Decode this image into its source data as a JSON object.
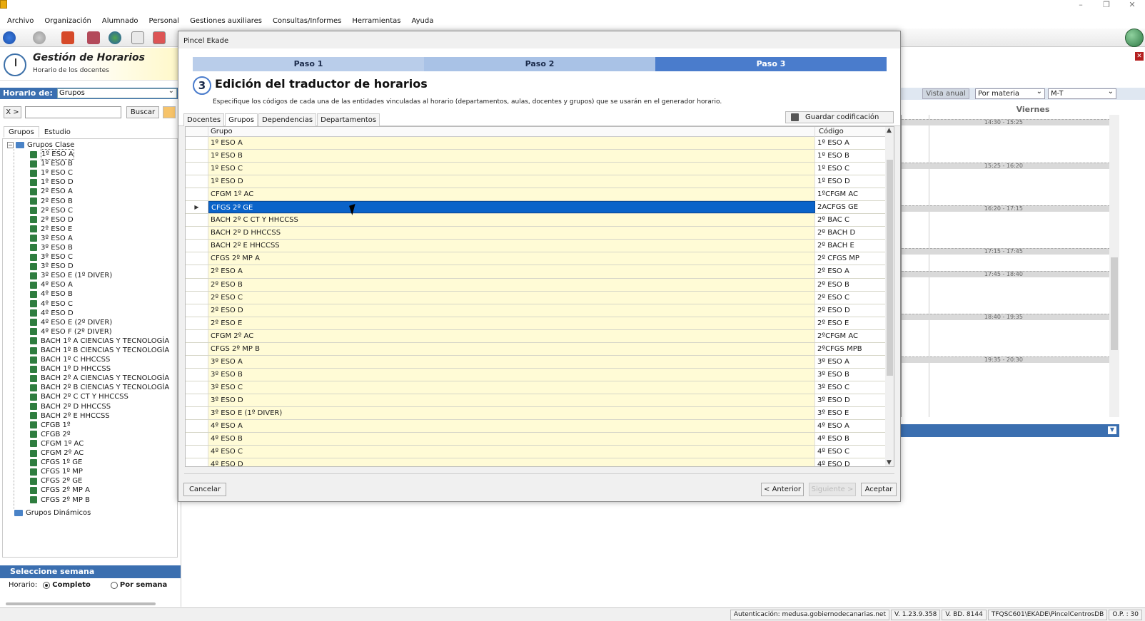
{
  "menu": [
    "Archivo",
    "Organización",
    "Alumnado",
    "Personal",
    "Gestiones auxiliares",
    "Consultas/Informes",
    "Herramientas",
    "Ayuda"
  ],
  "left": {
    "title": "Gestión de Horarios",
    "subtitle": "Horario de los docentes",
    "horario_de_label": "Horario de:",
    "horario_de_value": "Grupos",
    "filter_btn": "X >",
    "search_btn": "Buscar",
    "tabs": [
      "Grupos",
      "Estudio"
    ],
    "tree_root": "Grupos Clase",
    "tree_items": [
      "1º ESO A",
      "1º ESO B",
      "1º ESO C",
      "1º ESO D",
      "2º ESO A",
      "2º ESO B",
      "2º ESO C",
      "2º ESO D",
      "2º ESO E",
      "3º ESO A",
      "3º ESO B",
      "3º ESO C",
      "3º ESO D",
      "3º ESO E (1º DIVER)",
      "4º ESO A",
      "4º ESO B",
      "4º ESO C",
      "4º ESO D",
      "4º ESO E (2º DIVER)",
      "4º ESO F (2º DIVER)",
      "BACH 1º A CIENCIAS Y TECNOLOGÍA",
      "BACH 1º B CIENCIAS Y TECNOLOGÍA",
      "BACH 1º C HHCCSS",
      "BACH 1º D HHCCSS",
      "BACH 2º A CIENCIAS Y TECNOLOGÍA",
      "BACH 2º B CIENCIAS Y TECNOLOGÍA",
      "BACH 2º C CT Y HHCCSS",
      "BACH 2º D HHCCSS",
      "BACH 2º E HHCCSS",
      "CFGB 1º",
      "CFGB 2º",
      "CFGM 1º AC",
      "CFGM 2º AC",
      "CFGS 1º GE",
      "CFGS 1º MP",
      "CFGS 2º GE",
      "CFGS 2º MP A",
      "CFGS 2º MP B"
    ],
    "tree_dynamic": "Grupos Dinámicos",
    "select_week": "Seleccione semana",
    "horario_label": "Horario:",
    "opt_completo": "Completo",
    "opt_semana": "Por semana"
  },
  "right": {
    "vista_anual": "Vista anual",
    "por_materia": "Por materia",
    "mt": "M-T",
    "day": "Viernes",
    "slots": [
      "14:30 - 15:25",
      "15:25 - 16:20",
      "16:20 - 17:15",
      "17:15 - 17:45",
      "17:45 - 18:40",
      "18:40 - 19:35",
      "19:35 - 20:30"
    ]
  },
  "dialog": {
    "title": "Pincel Ekade",
    "steps": [
      "Paso 1",
      "Paso 2",
      "Paso 3"
    ],
    "step_number": "3",
    "step_title": "Edición del traductor de horarios",
    "step_desc": "Especifique los códigos de cada una de las entidades vinculadas al horario (departamentos, aulas, docentes y grupos) que se usarán en el generador horario.",
    "tabs": [
      "Docentes",
      "Grupos",
      "Dependencias",
      "Departamentos"
    ],
    "save_label": "Guardar codificación",
    "col_grupo": "Grupo",
    "col_codigo": "Código",
    "rows": [
      {
        "g": "1º ESO A",
        "c": "1º ESO A"
      },
      {
        "g": "1º ESO B",
        "c": "1º ESO B"
      },
      {
        "g": "1º ESO C",
        "c": "1º ESO C"
      },
      {
        "g": "1º ESO D",
        "c": "1º ESO D"
      },
      {
        "g": "CFGM 1º AC",
        "c": "1ºCFGM AC"
      },
      {
        "g": "CFGS 2º GE",
        "c": "2ACFGS GE"
      },
      {
        "g": "BACH 2º C CT Y HHCCSS",
        "c": "2º BAC C"
      },
      {
        "g": "BACH 2º D HHCCSS",
        "c": "2º BACH D"
      },
      {
        "g": "BACH 2º E HHCCSS",
        "c": "2º BACH E"
      },
      {
        "g": "CFGS 2º MP A",
        "c": "2º CFGS MP"
      },
      {
        "g": "2º ESO A",
        "c": "2º ESO A"
      },
      {
        "g": "2º ESO B",
        "c": "2º ESO B"
      },
      {
        "g": "2º ESO C",
        "c": "2º ESO C"
      },
      {
        "g": "2º ESO D",
        "c": "2º ESO D"
      },
      {
        "g": "2º ESO E",
        "c": "2º ESO E"
      },
      {
        "g": "CFGM 2º AC",
        "c": "2ºCFGM AC"
      },
      {
        "g": "CFGS 2º MP B",
        "c": "2ºCFGS MPB"
      },
      {
        "g": "3º ESO A",
        "c": "3º ESO A"
      },
      {
        "g": "3º ESO B",
        "c": "3º ESO B"
      },
      {
        "g": "3º ESO C",
        "c": "3º ESO C"
      },
      {
        "g": "3º ESO D",
        "c": "3º ESO D"
      },
      {
        "g": "3º ESO E (1º DIVER)",
        "c": "3º ESO E"
      },
      {
        "g": "4º ESO A",
        "c": "4º ESO A"
      },
      {
        "g": "4º ESO B",
        "c": "4º ESO B"
      },
      {
        "g": "4º ESO C",
        "c": "4º ESO C"
      },
      {
        "g": "4º ESO D",
        "c": "4º ESO D"
      }
    ],
    "cancel": "Cancelar",
    "prev": "< Anterior",
    "next": "Siguiente >",
    "accept": "Aceptar"
  },
  "status": [
    "Autenticación: medusa.gobiernodecanarias.net",
    "V. 1.23.9.358",
    "V. BD. 8144",
    "TFQSC601\\EKADE\\PincelCentrosDB",
    "O.P. : 30"
  ]
}
